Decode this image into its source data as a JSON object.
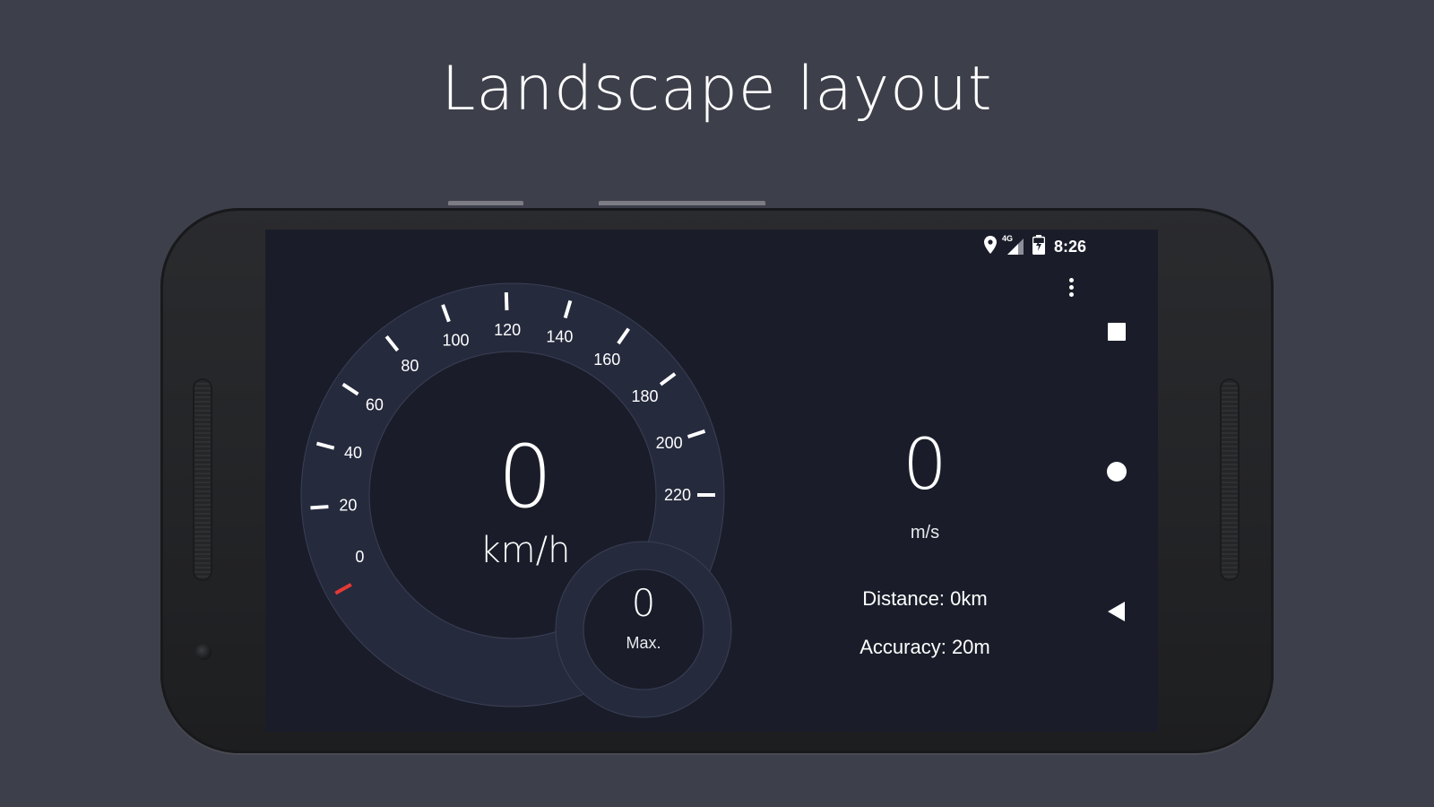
{
  "headline": "Landscape layout",
  "status_bar": {
    "network_label": "4G",
    "time": "8:26",
    "icons": [
      "location-pin-icon",
      "cell-signal-icon",
      "battery-charging-icon"
    ]
  },
  "gauge": {
    "min": 0,
    "max": 220,
    "ticks": [
      "0",
      "20",
      "40",
      "60",
      "80",
      "100",
      "120",
      "140",
      "160",
      "180",
      "200",
      "220"
    ],
    "current_speed": 0,
    "needle_color": "#e53935",
    "ring_color": "#252a3d"
  },
  "speed": {
    "value": "0",
    "unit": "km/h"
  },
  "max_speed": {
    "value": "0",
    "label": "Max."
  },
  "secondary_speed": {
    "value": "0",
    "unit": "m/s"
  },
  "stats": {
    "distance": "Distance: 0km",
    "accuracy": "Accuracy: 20m"
  },
  "nav_bar": {
    "icons": [
      "overview-square-icon",
      "home-circle-icon",
      "back-triangle-icon"
    ]
  },
  "colors": {
    "background": "#3d3f4b",
    "screen": "#1a1d29",
    "ring": "#252a3d",
    "text": "#ffffff",
    "accent": "#e53935"
  }
}
